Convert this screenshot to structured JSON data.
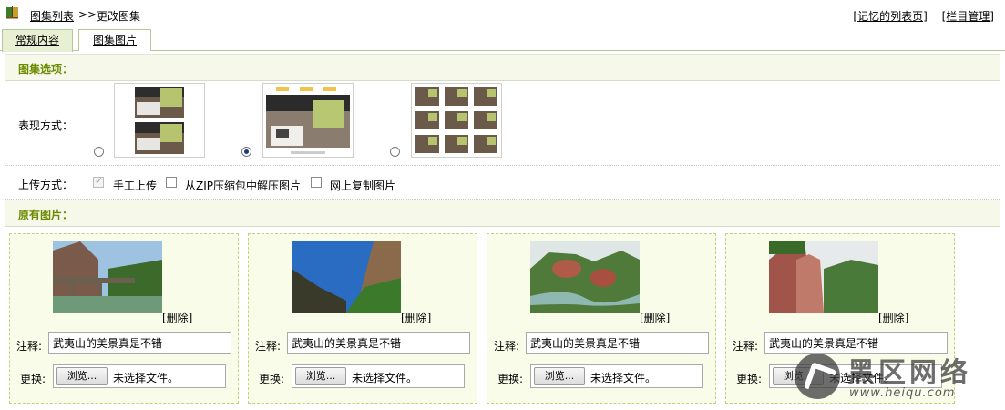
{
  "breadcrumb": {
    "list_link": "图集列表",
    "separator": ">>",
    "current": "更改图集"
  },
  "top_links": {
    "remembered_list": "[记忆的列表页]",
    "column_manage": "[栏目管理]"
  },
  "tabs": [
    {
      "label": "常规内容",
      "active": true
    },
    {
      "label": "图集图片",
      "active": false
    }
  ],
  "gallery_options": {
    "heading": "图集选项：",
    "display_mode_label": "表现方式：",
    "modes": [
      {
        "name": "two-stack",
        "selected": false
      },
      {
        "name": "slideshow",
        "selected": true
      },
      {
        "name": "grid-3x3",
        "selected": false
      }
    ],
    "upload_label": "上传方式：",
    "upload_options": [
      {
        "label": "手工上传",
        "checked": true
      },
      {
        "label": "从ZIP压缩包中解压图片",
        "checked": false
      },
      {
        "label": "网上复制图片",
        "checked": false
      }
    ]
  },
  "existing_pictures": {
    "heading": "原有图片：",
    "delete_label": "[删除]",
    "note_label": "注释:",
    "swap_label": "更换:",
    "browse_label": "浏览...",
    "no_file_label": "未选择文件。",
    "items": [
      {
        "note": "武夷山的美景真是不错"
      },
      {
        "note": "武夷山的美景真是不错"
      },
      {
        "note": "武夷山的美景真是不错"
      },
      {
        "note": "武夷山的美景真是不错"
      }
    ]
  },
  "watermark": {
    "title": "黑区网络",
    "url": "www.heiqu.com"
  },
  "colors": {
    "section_heading": "#6b8a00",
    "section_bg": "#f6f9e9",
    "card_bg": "#fafcea",
    "card_border": "#c7d07a",
    "tab_active_bg": "#e7f0d2"
  }
}
